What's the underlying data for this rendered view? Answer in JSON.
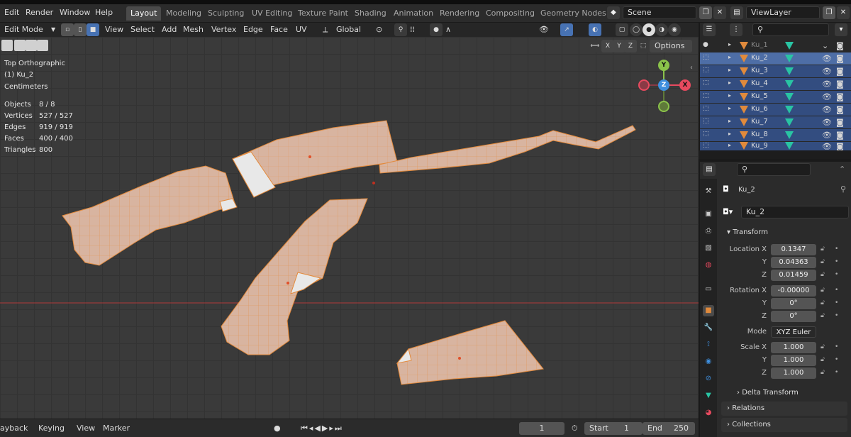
{
  "topbar": {
    "menus": [
      "Edit",
      "Render",
      "Window",
      "Help"
    ],
    "workspace_tabs": [
      "Layout",
      "Modeling",
      "Sculpting",
      "UV Editing",
      "Texture Paint",
      "Shading",
      "Animation",
      "Rendering",
      "Compositing",
      "Geometry Nodes"
    ],
    "active_tab": "Layout",
    "scene": "Scene",
    "view_layer": "ViewLayer"
  },
  "header": {
    "mode": "Edit Mode",
    "menus": [
      "View",
      "Select",
      "Add",
      "Mesh",
      "Vertex",
      "Edge",
      "Face",
      "UV"
    ],
    "orientation": "Global",
    "axis_buttons": [
      "X",
      "Y",
      "Z"
    ],
    "options_label": "Options"
  },
  "viewport": {
    "view_name": "Top Orthographic",
    "active_object": "(1) Ku_2",
    "units": "Centimeters",
    "stats": [
      {
        "label": "Objects",
        "value": "8 / 8"
      },
      {
        "label": "Vertices",
        "value": "527 / 527"
      },
      {
        "label": "Edges",
        "value": "919 / 919"
      },
      {
        "label": "Faces",
        "value": "400 / 400"
      },
      {
        "label": "Triangles",
        "value": "800"
      }
    ],
    "gizmo": {
      "y": "Y",
      "z": "Z",
      "x": "X"
    }
  },
  "timeline": {
    "playback": "ayback",
    "keying": "Keying",
    "view": "View",
    "marker": "Marker",
    "current_frame": "1",
    "start_label": "Start",
    "start_value": "1",
    "end_label": "End",
    "end_value": "250"
  },
  "outliner": {
    "items": [
      "Ku_1",
      "Ku_2",
      "Ku_3",
      "Ku_4",
      "Ku_5",
      "Ku_6",
      "Ku_7",
      "Ku_8",
      "Ku_9"
    ]
  },
  "properties": {
    "object_name": "Ku_2",
    "object_field": "Ku_2",
    "transform_label": "Transform",
    "location": {
      "label": "Location X",
      "x": "0.1347",
      "y": "0.04363",
      "z": "0.01459"
    },
    "rotation": {
      "label": "Rotation X",
      "x": "-0.00000",
      "y": "0°",
      "z": "0°"
    },
    "mode_label": "Mode",
    "mode_value": "XYZ Euler",
    "scale": {
      "label": "Scale X",
      "x": "1.000",
      "y": "1.000",
      "z": "1.000"
    },
    "axis_y": "Y",
    "axis_z": "Z",
    "delta_transform": "Delta Transform",
    "relations": "Relations",
    "collections": "Collections"
  },
  "colors": {
    "mesh_fill": "#d8b4a0",
    "mesh_edge": "#e38a3c",
    "selection": "#4772b3",
    "x_axis": "#e84a5f",
    "y_axis": "#8bc34a",
    "z_axis": "#3f8fde"
  }
}
